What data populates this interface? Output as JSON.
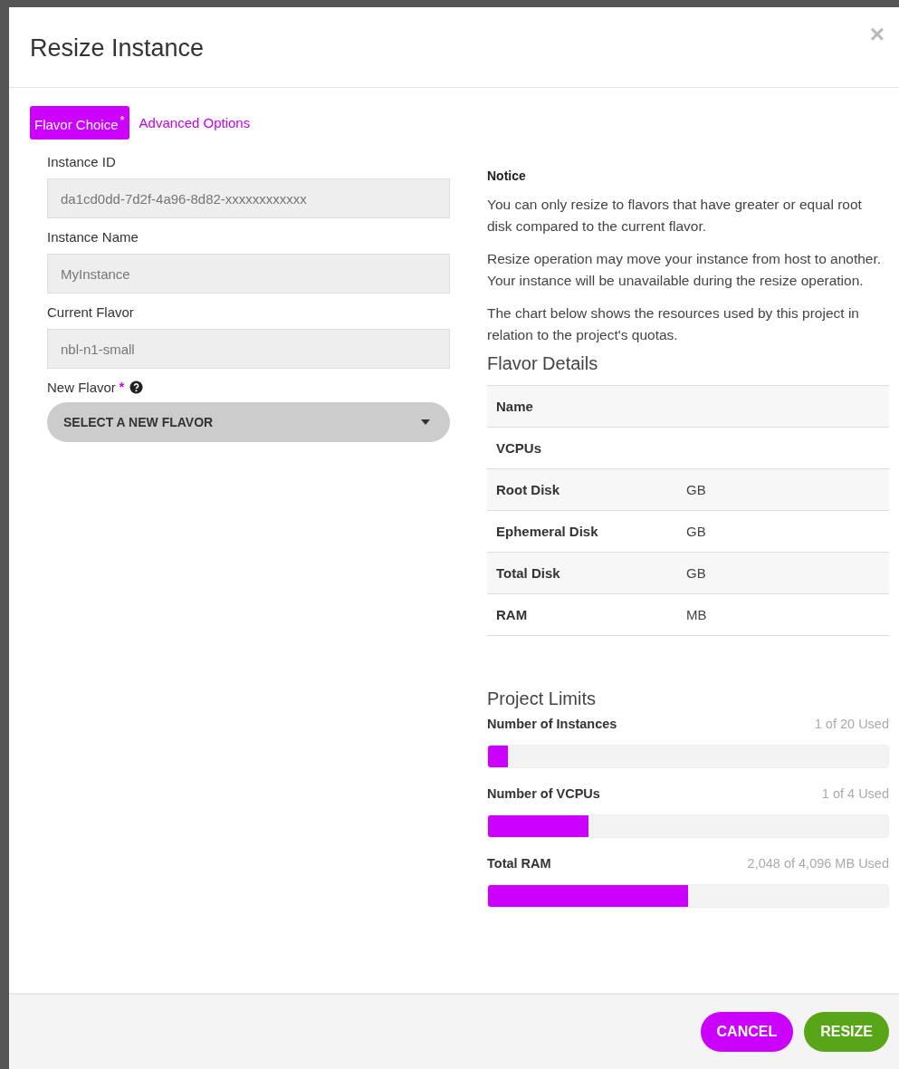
{
  "dialog": {
    "title": "Resize Instance",
    "close": "×"
  },
  "tabs": [
    {
      "label": "Flavor Choice",
      "selected": true,
      "required_mark": "*"
    },
    {
      "label": "Advanced Options",
      "selected": false
    }
  ],
  "fields": [
    {
      "label": "Instance ID",
      "value": "da1cd0dd-7d2f-4a96-8d82-xxxxxxxxxxxx",
      "kind": "text"
    },
    {
      "label": "Instance Name",
      "value": "MyInstance",
      "kind": "text"
    },
    {
      "label": "Current Flavor",
      "value": "nbl-n1-small",
      "kind": "text"
    },
    {
      "label": "New Flavor",
      "value": "SELECT A NEW FLAVOR",
      "kind": "select",
      "required_mark": "*",
      "help": true
    }
  ],
  "notice": {
    "title": "Notice",
    "paragraphs": [
      "You can only resize to flavors that have greater or equal root disk compared to the current flavor.",
      "Resize operation may move your instance from host to another. Your instance will be unavailable during the resize operation.",
      "The chart below shows the resources used by this project in relation to the project's quotas."
    ]
  },
  "flavor_details": {
    "title": "Flavor Details",
    "rows": [
      {
        "label": "Name"
      },
      {
        "label": "VCPUs"
      },
      {
        "label": "Root Disk",
        "value": "GB"
      },
      {
        "label": "Ephemeral Disk",
        "value": "GB"
      },
      {
        "label": "Total Disk",
        "value": "GB"
      },
      {
        "label": "RAM",
        "value": "MB"
      }
    ]
  },
  "project_limits": {
    "title": "Project Limits",
    "items": [
      {
        "label": "Number of Instances",
        "reading": "1 of 20 Used",
        "level": 0.05
      },
      {
        "label": "Number of VCPUs",
        "reading": "1 of 4 Used",
        "level": 0.25
      },
      {
        "label": "Total RAM",
        "reading": "2,048 of 4,096 MB Used",
        "level": 0.5
      }
    ]
  },
  "buttons": [
    {
      "label": "CANCEL",
      "kind": "cancel"
    },
    {
      "label": "RESIZE",
      "kind": "primary"
    }
  ]
}
